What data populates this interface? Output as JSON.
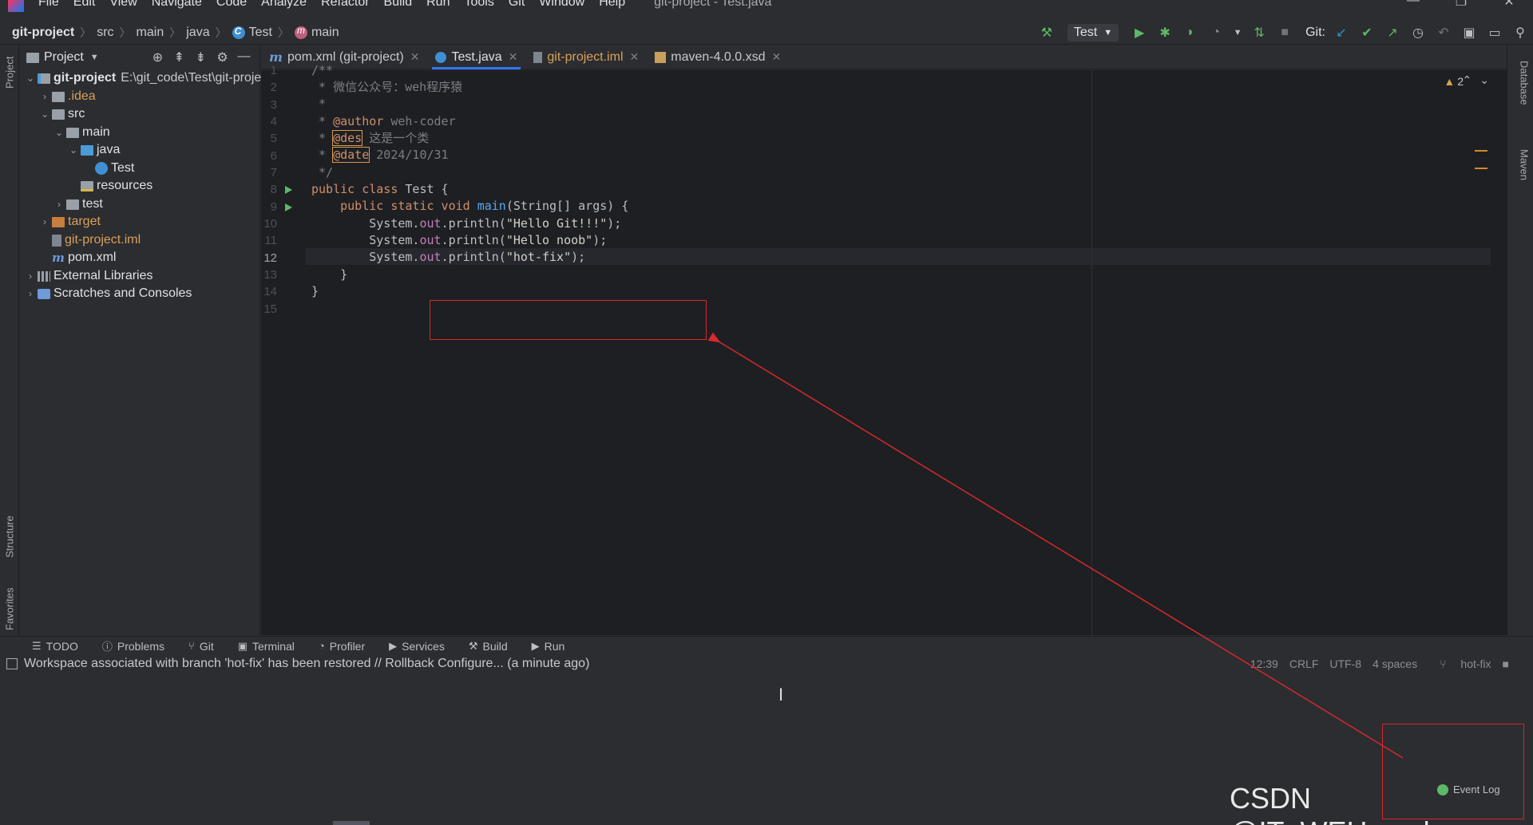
{
  "menubar": {
    "items": [
      "File",
      "Edit",
      "View",
      "Navigate",
      "Code",
      "Analyze",
      "Refactor",
      "Build",
      "Run",
      "Tools",
      "Git",
      "Window",
      "Help"
    ],
    "window_title": "git-project - Test.java"
  },
  "navbar": {
    "crumbs": [
      "git-project",
      "src",
      "main",
      "java",
      "Test",
      "main"
    ]
  },
  "toolbar": {
    "run_config": "Test",
    "git_label": "Git:"
  },
  "project_panel": {
    "title": "Project",
    "tree": [
      {
        "label": "git-project",
        "note": "E:\\git_code\\Test\\git-project"
      },
      {
        "label": ".idea"
      },
      {
        "label": "src"
      },
      {
        "label": "main"
      },
      {
        "label": "java"
      },
      {
        "label": "Test"
      },
      {
        "label": "resources"
      },
      {
        "label": "test"
      },
      {
        "label": "target"
      },
      {
        "label": "git-project.iml"
      },
      {
        "label": "pom.xml"
      },
      {
        "label": "External Libraries"
      },
      {
        "label": "Scratches and Consoles"
      }
    ]
  },
  "editor_tabs": [
    {
      "label": "pom.xml (git-project)",
      "active": false
    },
    {
      "label": "Test.java",
      "active": true
    },
    {
      "label": "git-project.iml",
      "active": false
    },
    {
      "label": "maven-4.0.0.xsd",
      "active": false
    }
  ],
  "editor": {
    "current_line": 12,
    "warning_count": "2",
    "line_numbers": [
      "1",
      "2",
      "3",
      "4",
      "5",
      "6",
      "7",
      "8",
      "9",
      "10",
      "11",
      "12",
      "13",
      "14",
      "15"
    ],
    "code": {
      "l1": "/**",
      "l2": " * 微信公众号：weh程序猿",
      "l3": " *",
      "l4_star": " * ",
      "l4_tag": "@author",
      "l4_text": " weh-coder",
      "l5_star": " * ",
      "l5_tag": "@des",
      "l5_text": " 这是一个类",
      "l6_star": " * ",
      "l6_tag": "@date",
      "l6_text": " 2024/10/31",
      "l7": " */",
      "l8_kw": "public class ",
      "l8_name": "Test",
      "l8_rest": " {",
      "l9_kw": "    public static void ",
      "l9_fn": "main",
      "l9_rest": "(String[] args) {",
      "l10_sys": "        System.",
      "l10_out": "out",
      "l10_mid": ".println(",
      "l10_str": "\"Hello Git!!!\"",
      "l10_end": ");",
      "l11_sys": "        System.",
      "l11_out": "out",
      "l11_mid": ".println(",
      "l11_str": "\"Hello noob\"",
      "l11_end": ");",
      "l12_sys": "        System.",
      "l12_out": "out",
      "l12_mid": ".println(",
      "l12_str": "\"hot-fix\"",
      "l12_end": ");",
      "l13": "    }",
      "l14": "}",
      "l15": ""
    }
  },
  "left_strip": {
    "project": "Project",
    "structure": "Structure",
    "favorites": "Favorites"
  },
  "right_strip": {
    "database": "Database",
    "maven": "Maven"
  },
  "bottom_tabs": [
    "TODO",
    "Problems",
    "Git",
    "Terminal",
    "Profiler",
    "Services",
    "Build",
    "Run"
  ],
  "statusbar": {
    "message": "Workspace associated with branch 'hot-fix' has been restored // Rollback   Configure... (a minute ago)",
    "position": "12:39",
    "line_sep": "CRLF",
    "encoding": "UTF-8",
    "indent": "4 spaces",
    "branch": "hot-fix"
  },
  "event_log": "Event Log",
  "watermark": "CSDN @IT_WEH_coder",
  "colors": {
    "accent": "#3574f0",
    "annotation_red": "#d6282e",
    "run_green": "#5fb865"
  }
}
